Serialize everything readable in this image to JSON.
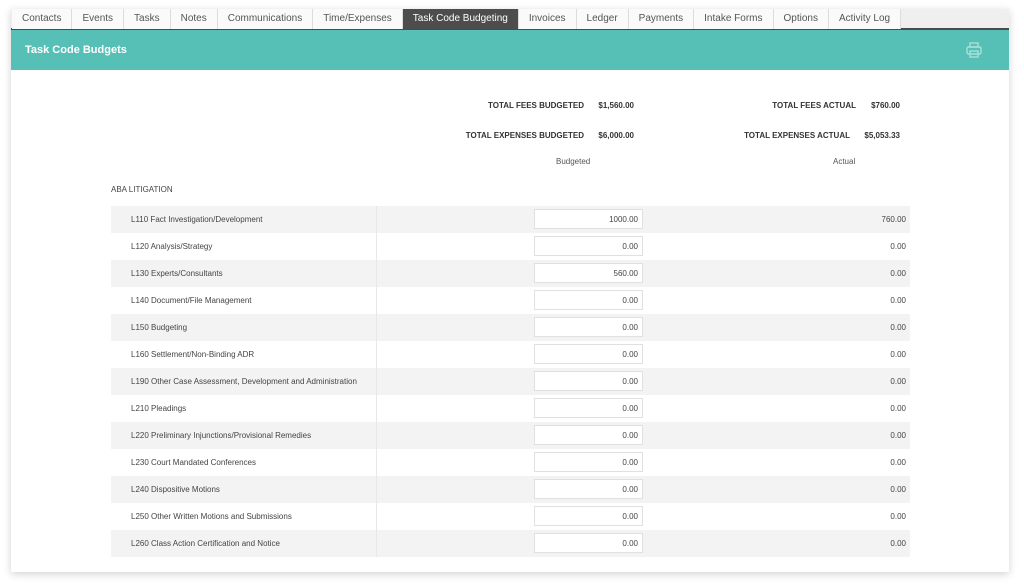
{
  "tabs": [
    {
      "label": "Contacts",
      "active": false
    },
    {
      "label": "Events",
      "active": false
    },
    {
      "label": "Tasks",
      "active": false
    },
    {
      "label": "Notes",
      "active": false
    },
    {
      "label": "Communications",
      "active": false
    },
    {
      "label": "Time/Expenses",
      "active": false
    },
    {
      "label": "Task Code Budgeting",
      "active": true
    },
    {
      "label": "Invoices",
      "active": false
    },
    {
      "label": "Ledger",
      "active": false
    },
    {
      "label": "Payments",
      "active": false
    },
    {
      "label": "Intake Forms",
      "active": false
    },
    {
      "label": "Options",
      "active": false
    },
    {
      "label": "Activity Log",
      "active": false
    }
  ],
  "header": {
    "title": "Task Code Budgets",
    "print_icon": "printer-icon"
  },
  "totals": {
    "fees_budgeted_label": "TOTAL FEES BUDGETED",
    "fees_budgeted_value": "$1,560.00",
    "expenses_budgeted_label": "TOTAL EXPENSES BUDGETED",
    "expenses_budgeted_value": "$6,000.00",
    "fees_actual_label": "TOTAL FEES ACTUAL",
    "fees_actual_value": "$760.00",
    "expenses_actual_label": "TOTAL EXPENSES ACTUAL",
    "expenses_actual_value": "$5,053.33"
  },
  "columns": {
    "budgeted": "Budgeted",
    "actual": "Actual"
  },
  "section": "ABA LITIGATION",
  "rows": [
    {
      "name": "L110 Fact Investigation/Development",
      "budgeted": "1000.00",
      "actual": "760.00"
    },
    {
      "name": "L120 Analysis/Strategy",
      "budgeted": "0.00",
      "actual": "0.00"
    },
    {
      "name": "L130 Experts/Consultants",
      "budgeted": "560.00",
      "actual": "0.00"
    },
    {
      "name": "L140 Document/File Management",
      "budgeted": "0.00",
      "actual": "0.00"
    },
    {
      "name": "L150 Budgeting",
      "budgeted": "0.00",
      "actual": "0.00"
    },
    {
      "name": "L160 Settlement/Non-Binding ADR",
      "budgeted": "0.00",
      "actual": "0.00"
    },
    {
      "name": "L190 Other Case Assessment, Development and Administration",
      "budgeted": "0.00",
      "actual": "0.00"
    },
    {
      "name": "L210 Pleadings",
      "budgeted": "0.00",
      "actual": "0.00"
    },
    {
      "name": "L220 Preliminary Injunctions/Provisional Remedies",
      "budgeted": "0.00",
      "actual": "0.00"
    },
    {
      "name": "L230 Court Mandated Conferences",
      "budgeted": "0.00",
      "actual": "0.00"
    },
    {
      "name": "L240 Dispositive Motions",
      "budgeted": "0.00",
      "actual": "0.00"
    },
    {
      "name": "L250 Other Written Motions and Submissions",
      "budgeted": "0.00",
      "actual": "0.00"
    },
    {
      "name": "L260 Class Action Certification and Notice",
      "budgeted": "0.00",
      "actual": "0.00"
    }
  ],
  "colors": {
    "accent": "#56c0b7",
    "active_tab": "#4d4d4d"
  }
}
